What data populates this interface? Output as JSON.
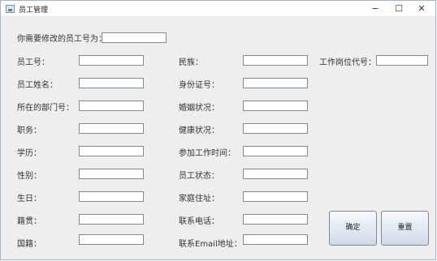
{
  "window": {
    "title": "员工管理",
    "minimize_glyph": "−",
    "maximize_glyph": "☐",
    "close_glyph": "✕"
  },
  "search": {
    "label": "你需要修改的员工号为：",
    "value": ""
  },
  "col1": [
    {
      "label": "员工号：",
      "value": ""
    },
    {
      "label": "员工姓名：",
      "value": ""
    },
    {
      "label": "所在的部门号：",
      "value": ""
    },
    {
      "label": "职务：",
      "value": ""
    },
    {
      "label": "学历：",
      "value": ""
    },
    {
      "label": "性别：",
      "value": ""
    },
    {
      "label": "生日：",
      "value": ""
    },
    {
      "label": "籍贯：",
      "value": ""
    },
    {
      "label": "国籍：",
      "value": ""
    }
  ],
  "col2": [
    {
      "label": "民族：",
      "value": ""
    },
    {
      "label": "身份证号：",
      "value": ""
    },
    {
      "label": "婚姻状况：",
      "value": ""
    },
    {
      "label": "健康状况：",
      "value": ""
    },
    {
      "label": "参加工作时间：",
      "value": ""
    },
    {
      "label": "员工状态：",
      "value": ""
    },
    {
      "label": "家庭住址：",
      "value": ""
    },
    {
      "label": "联系电话：",
      "value": ""
    },
    {
      "label": "联系Email地址：",
      "value": ""
    }
  ],
  "col3": {
    "label": "工作岗位代号：",
    "value": ""
  },
  "buttons": {
    "confirm": "确定",
    "reset": "重置"
  }
}
